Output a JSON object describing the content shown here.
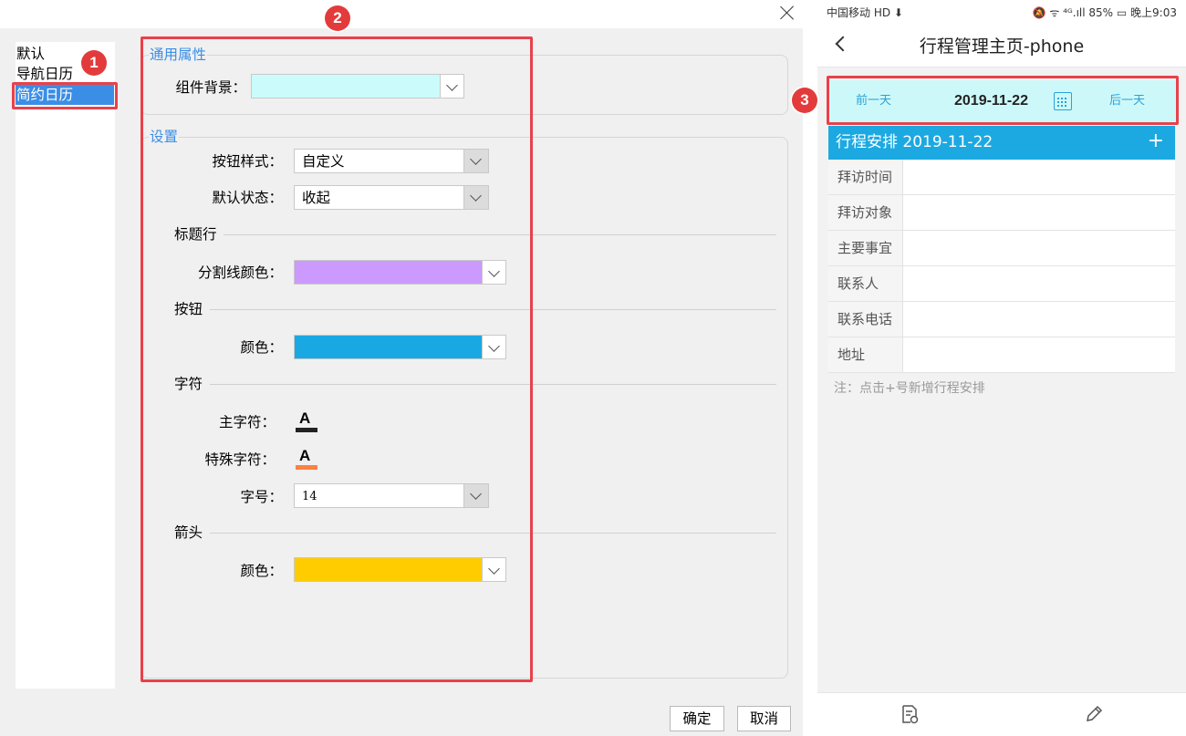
{
  "dialog": {
    "style_list": [
      "默认",
      "导航日历",
      "简约日历"
    ],
    "selected_style": "简约日历",
    "groups": {
      "general": "通用属性",
      "settings": "设置"
    },
    "fields": {
      "background_label": "组件背景：",
      "button_style_label": "按钮样式：",
      "button_style_value": "自定义",
      "default_state_label": "默认状态：",
      "default_state_value": "收起",
      "title_row_section": "标题行",
      "divider_color_label": "分割线颜色：",
      "button_section": "按钮",
      "button_color_label": "颜色：",
      "chars_section": "字符",
      "main_char_label": "主字符：",
      "special_char_label": "特殊字符：",
      "font_size_label": "字号：",
      "font_size_value": "14",
      "arrow_section": "箭头",
      "arrow_color_label": "颜色："
    },
    "font_glyph": "A",
    "colors": {
      "background": "#cbfbfb",
      "divider": "#cc99ff",
      "button": "#1aa8e2",
      "main_char_bar": "#222222",
      "special_char_bar": "#ff8040",
      "arrow": "#ffcc00"
    },
    "buttons": {
      "ok": "确定",
      "cancel": "取消"
    }
  },
  "badges": [
    "1",
    "2",
    "3"
  ],
  "phone": {
    "status_left": "中国移动 HD ⬇",
    "status_right": "🔕 ᯤ ⁴ᴳ.ıll 85% ▭ 晚上9:03",
    "title": "行程管理主页-phone",
    "prev_day": "前一天",
    "date": "2019-11-22",
    "next_day": "后一天",
    "schedule_header": "行程安排  2019-11-22",
    "add": "+",
    "rows": [
      "拜访时间",
      "拜访对象",
      "主要事宜",
      "联系人",
      "联系电话",
      "地址"
    ],
    "note": "注：点击+号新增行程安排",
    "icons": [
      "calendar-icon",
      "back-arrow-icon",
      "document-refresh-icon",
      "pencil-icon"
    ]
  }
}
